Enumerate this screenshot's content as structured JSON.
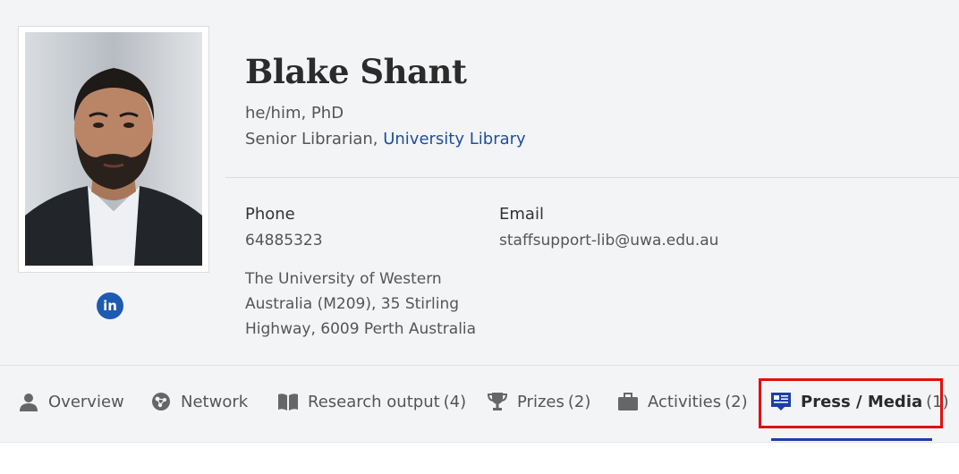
{
  "profile": {
    "name": "Blake Shant",
    "pronouns_degree": "he/him, PhD",
    "position_prefix": "Senior Librarian, ",
    "department": "University Library",
    "phone_label": "Phone",
    "phone_value": "64885323",
    "email_label": "Email",
    "email_value": "staffsupport-lib@uwa.edu.au",
    "address": "The University of Western Australia (M209), 35 Stirling Highway, 6009 Perth Australia",
    "linkedin_label": "in"
  },
  "tabs": [
    {
      "label": "Overview",
      "count": "",
      "icon": "person-icon"
    },
    {
      "label": "Network",
      "count": "",
      "icon": "network-icon"
    },
    {
      "label": "Research output",
      "count": "(4)",
      "icon": "book-icon"
    },
    {
      "label": "Prizes",
      "count": "(2)",
      "icon": "trophy-icon"
    },
    {
      "label": "Activities",
      "count": "(2)",
      "icon": "briefcase-icon"
    },
    {
      "label": "Press / Media",
      "count": "(1)",
      "icon": "newspaper-icon",
      "active": true
    }
  ],
  "colors": {
    "accent": "#1d3fa3",
    "link": "#1d4f9c",
    "highlight": "#e01010",
    "background": "#f3f4f6"
  }
}
